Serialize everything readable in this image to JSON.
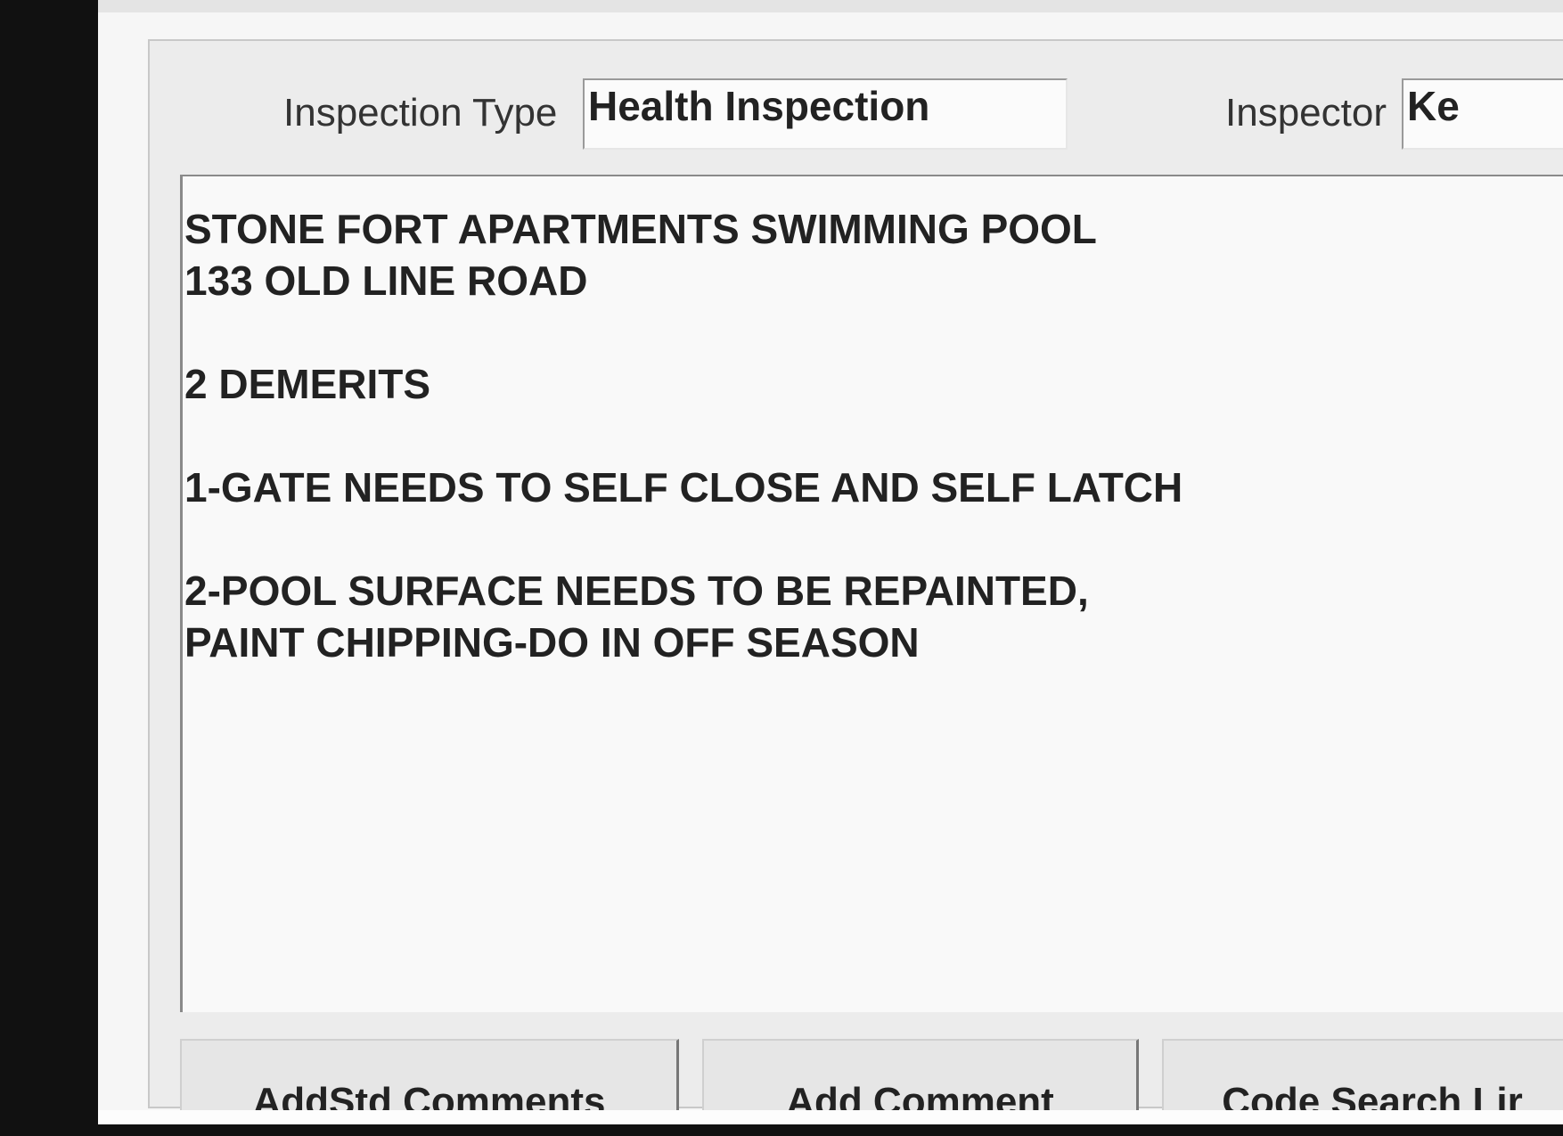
{
  "form": {
    "inspection_type_label": "Inspection Type",
    "inspection_type_value": "Health Inspection",
    "inspector_label": "Inspector",
    "inspector_value": "Ke"
  },
  "comments": {
    "lines": [
      "STONE FORT APARTMENTS SWIMMING POOL",
      "133 OLD LINE ROAD",
      "",
      "2 DEMERITS",
      "",
      "1-GATE NEEDS TO SELF CLOSE AND SELF LATCH",
      "",
      "2-POOL SURFACE NEEDS TO BE REPAINTED,",
      "PAINT CHIPPING-DO IN OFF SEASON"
    ]
  },
  "buttons": {
    "add_std_comments": {
      "pre": "Add ",
      "mnemonic": "S",
      "post": "td Comments"
    },
    "add_comment": {
      "pre": "",
      "mnemonic": "A",
      "post": "dd Comment"
    },
    "code_search": "Code Search Lir"
  }
}
